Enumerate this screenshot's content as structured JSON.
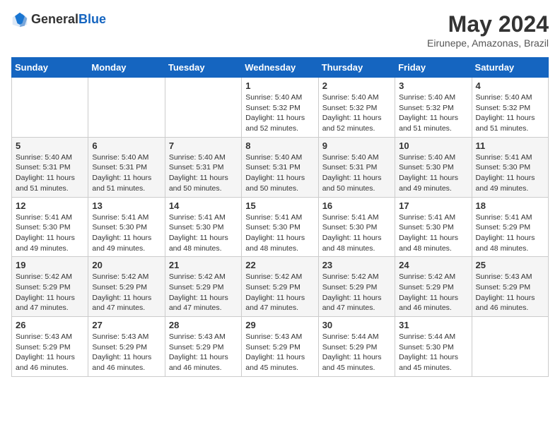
{
  "header": {
    "logo_general": "General",
    "logo_blue": "Blue",
    "month_title": "May 2024",
    "location": "Eirunepe, Amazonas, Brazil"
  },
  "days_of_week": [
    "Sunday",
    "Monday",
    "Tuesday",
    "Wednesday",
    "Thursday",
    "Friday",
    "Saturday"
  ],
  "weeks": [
    [
      {
        "day": "",
        "info": ""
      },
      {
        "day": "",
        "info": ""
      },
      {
        "day": "",
        "info": ""
      },
      {
        "day": "1",
        "info": "Sunrise: 5:40 AM\nSunset: 5:32 PM\nDaylight: 11 hours\nand 52 minutes."
      },
      {
        "day": "2",
        "info": "Sunrise: 5:40 AM\nSunset: 5:32 PM\nDaylight: 11 hours\nand 52 minutes."
      },
      {
        "day": "3",
        "info": "Sunrise: 5:40 AM\nSunset: 5:32 PM\nDaylight: 11 hours\nand 51 minutes."
      },
      {
        "day": "4",
        "info": "Sunrise: 5:40 AM\nSunset: 5:32 PM\nDaylight: 11 hours\nand 51 minutes."
      }
    ],
    [
      {
        "day": "5",
        "info": "Sunrise: 5:40 AM\nSunset: 5:31 PM\nDaylight: 11 hours\nand 51 minutes."
      },
      {
        "day": "6",
        "info": "Sunrise: 5:40 AM\nSunset: 5:31 PM\nDaylight: 11 hours\nand 51 minutes."
      },
      {
        "day": "7",
        "info": "Sunrise: 5:40 AM\nSunset: 5:31 PM\nDaylight: 11 hours\nand 50 minutes."
      },
      {
        "day": "8",
        "info": "Sunrise: 5:40 AM\nSunset: 5:31 PM\nDaylight: 11 hours\nand 50 minutes."
      },
      {
        "day": "9",
        "info": "Sunrise: 5:40 AM\nSunset: 5:31 PM\nDaylight: 11 hours\nand 50 minutes."
      },
      {
        "day": "10",
        "info": "Sunrise: 5:40 AM\nSunset: 5:30 PM\nDaylight: 11 hours\nand 49 minutes."
      },
      {
        "day": "11",
        "info": "Sunrise: 5:41 AM\nSunset: 5:30 PM\nDaylight: 11 hours\nand 49 minutes."
      }
    ],
    [
      {
        "day": "12",
        "info": "Sunrise: 5:41 AM\nSunset: 5:30 PM\nDaylight: 11 hours\nand 49 minutes."
      },
      {
        "day": "13",
        "info": "Sunrise: 5:41 AM\nSunset: 5:30 PM\nDaylight: 11 hours\nand 49 minutes."
      },
      {
        "day": "14",
        "info": "Sunrise: 5:41 AM\nSunset: 5:30 PM\nDaylight: 11 hours\nand 48 minutes."
      },
      {
        "day": "15",
        "info": "Sunrise: 5:41 AM\nSunset: 5:30 PM\nDaylight: 11 hours\nand 48 minutes."
      },
      {
        "day": "16",
        "info": "Sunrise: 5:41 AM\nSunset: 5:30 PM\nDaylight: 11 hours\nand 48 minutes."
      },
      {
        "day": "17",
        "info": "Sunrise: 5:41 AM\nSunset: 5:30 PM\nDaylight: 11 hours\nand 48 minutes."
      },
      {
        "day": "18",
        "info": "Sunrise: 5:41 AM\nSunset: 5:29 PM\nDaylight: 11 hours\nand 48 minutes."
      }
    ],
    [
      {
        "day": "19",
        "info": "Sunrise: 5:42 AM\nSunset: 5:29 PM\nDaylight: 11 hours\nand 47 minutes."
      },
      {
        "day": "20",
        "info": "Sunrise: 5:42 AM\nSunset: 5:29 PM\nDaylight: 11 hours\nand 47 minutes."
      },
      {
        "day": "21",
        "info": "Sunrise: 5:42 AM\nSunset: 5:29 PM\nDaylight: 11 hours\nand 47 minutes."
      },
      {
        "day": "22",
        "info": "Sunrise: 5:42 AM\nSunset: 5:29 PM\nDaylight: 11 hours\nand 47 minutes."
      },
      {
        "day": "23",
        "info": "Sunrise: 5:42 AM\nSunset: 5:29 PM\nDaylight: 11 hours\nand 47 minutes."
      },
      {
        "day": "24",
        "info": "Sunrise: 5:42 AM\nSunset: 5:29 PM\nDaylight: 11 hours\nand 46 minutes."
      },
      {
        "day": "25",
        "info": "Sunrise: 5:43 AM\nSunset: 5:29 PM\nDaylight: 11 hours\nand 46 minutes."
      }
    ],
    [
      {
        "day": "26",
        "info": "Sunrise: 5:43 AM\nSunset: 5:29 PM\nDaylight: 11 hours\nand 46 minutes."
      },
      {
        "day": "27",
        "info": "Sunrise: 5:43 AM\nSunset: 5:29 PM\nDaylight: 11 hours\nand 46 minutes."
      },
      {
        "day": "28",
        "info": "Sunrise: 5:43 AM\nSunset: 5:29 PM\nDaylight: 11 hours\nand 46 minutes."
      },
      {
        "day": "29",
        "info": "Sunrise: 5:43 AM\nSunset: 5:29 PM\nDaylight: 11 hours\nand 45 minutes."
      },
      {
        "day": "30",
        "info": "Sunrise: 5:44 AM\nSunset: 5:29 PM\nDaylight: 11 hours\nand 45 minutes."
      },
      {
        "day": "31",
        "info": "Sunrise: 5:44 AM\nSunset: 5:30 PM\nDaylight: 11 hours\nand 45 minutes."
      },
      {
        "day": "",
        "info": ""
      }
    ]
  ]
}
